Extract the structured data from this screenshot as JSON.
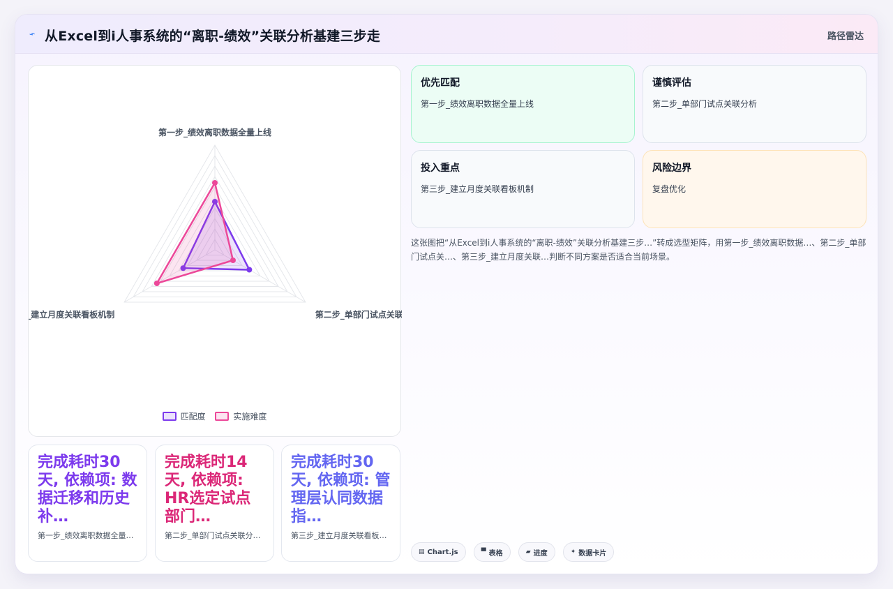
{
  "header": {
    "icon": "route-icon",
    "title": "从Excel到i人事系统的“离职-绩效”关联分析基建三步走",
    "tag": "路径雷达"
  },
  "chart_data": {
    "type": "radar",
    "categories": [
      "第一步_绩效离职数据全量上线",
      "第二步_单部门试点关联分析",
      "第三步_建立月度关联看板机制"
    ],
    "series": [
      {
        "name": "匹配度",
        "values": [
          4.6,
          3.8,
          3.5
        ],
        "color": "#7c3aed"
      },
      {
        "name": "实施难度",
        "values": [
          6.4,
          2.0,
          6.4
        ],
        "color": "#ec4899"
      }
    ],
    "rlim": [
      0,
      10
    ],
    "legend_position": "bottom"
  },
  "stats": [
    {
      "value": "完成耗时30天, 依赖项: 数据迁移和历史补…",
      "label": "第一步_绩效离职数据全量…",
      "color": "#7c3aed"
    },
    {
      "value": "完成耗时14天, 依赖项: HR选定试点部门…",
      "label": "第二步_单部门试点关联分…",
      "color": "#db2777"
    },
    {
      "value": "完成耗时30天, 依赖项: 管理层认同数据指…",
      "label": "第三步_建立月度关联看板…",
      "color": "#6366f1"
    }
  ],
  "matrix": [
    {
      "title": "优先匹配",
      "subtitle": "第一步_绩效离职数据全量上线",
      "bg": "#ecfdf5",
      "border": "#a7f3d0"
    },
    {
      "title": "谨慎评估",
      "subtitle": "第二步_单部门试点关联分析",
      "bg": "#f8fafc",
      "border": "#dde3ec"
    },
    {
      "title": "投入重点",
      "subtitle": "第三步_建立月度关联看板机制",
      "bg": "#f8fafc",
      "border": "#dde3ec"
    },
    {
      "title": "风险边界",
      "subtitle": "复盘优化",
      "bg": "#fff7ed",
      "border": "#fde3b8"
    }
  ],
  "description": "这张图把“从Excel到i人事系统的“离职-绩效”关联分析基建三步…”转成选型矩阵，用第一步_绩效离职数据…、第二步_单部门试点关…、第三步_建立月度关联…判断不同方案是否适合当前场景。",
  "chips": [
    {
      "icon": "chart-icon",
      "glyph": "▤",
      "label": "Chart.js"
    },
    {
      "icon": "table-icon",
      "glyph": "▀",
      "label": "表格"
    },
    {
      "icon": "progress-icon",
      "glyph": "▰",
      "label": "进度"
    },
    {
      "icon": "data-card-icon",
      "glyph": "✦",
      "label": "数据卡片"
    }
  ]
}
